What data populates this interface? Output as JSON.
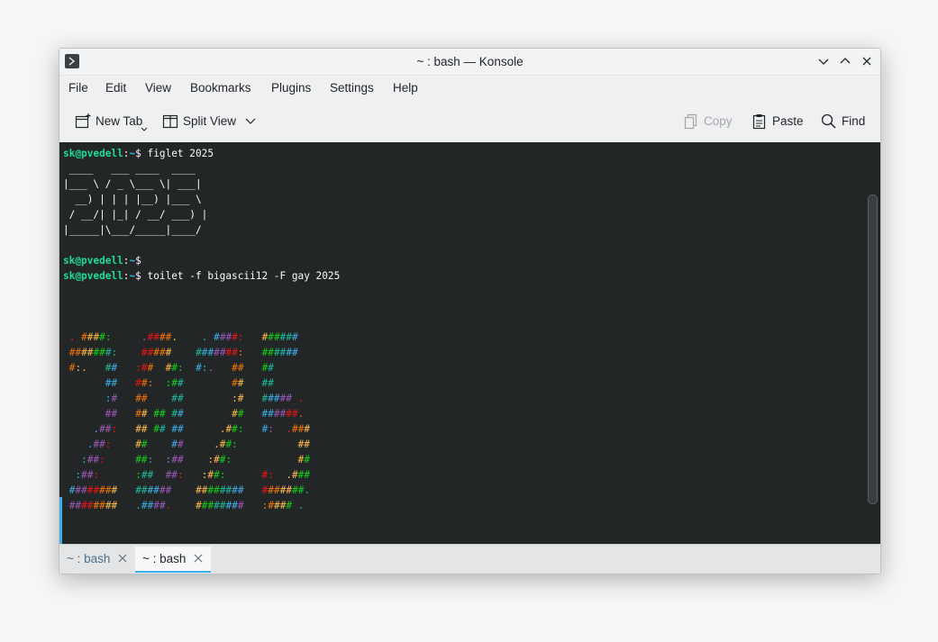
{
  "window": {
    "title": "~ : bash — Konsole"
  },
  "menu": {
    "items": [
      "File",
      "Edit",
      "View",
      "Bookmarks",
      "Plugins",
      "Settings",
      "Help"
    ]
  },
  "toolbar": {
    "new_tab": "New Tab",
    "split_view": "Split View",
    "copy": "Copy",
    "paste": "Paste",
    "find": "Find"
  },
  "terminal": {
    "prompt_user": "sk@pvedell",
    "prompt_sep": ":",
    "prompt_path": "~",
    "prompt_symbol": "$",
    "cmd1": " figlet 2025",
    "cmd2": "",
    "cmd3": " toilet -f bigascii12 -F gay 2025",
    "figlet": [
      " ____   ___ ____  ____",
      "|___ \\ / _ \\___ \\| ___|",
      "  __) | | | |__) |___ \\",
      " / __/| |_| / __/ ___) |",
      "|_____|\\___/_____|____/"
    ],
    "toilet": [
      " . ####:     .####.    . ####:   ######",
      " #######:    #####    #######:   ######",
      " #:.   ##   :##  ##:  #:.   ##   ##",
      "       ##   ##:  :##        ##   ##",
      "       :#   ##    ##        :#   ##### .",
      "       ##   ## ## ##        ##   ######.",
      "     .##:   ## ## ##      .##:   #:  .###",
      "    .##:    ##    ##     .##:          ##",
      "   :##:     ##:  :##    :##:           ##",
      "  :##:      :##  ##:   :##:      #:  .###",
      " ########   ######    ########   #######.",
      " ########   .####.    ########   :#### ."
    ],
    "toilet_colors": [
      "c-r",
      "c-o",
      "c-y",
      "c-g",
      "c-c",
      "c-b",
      "c-m"
    ]
  },
  "tabs": [
    {
      "label": "~ : bash",
      "active": false
    },
    {
      "label": "~ : bash",
      "active": true
    }
  ]
}
